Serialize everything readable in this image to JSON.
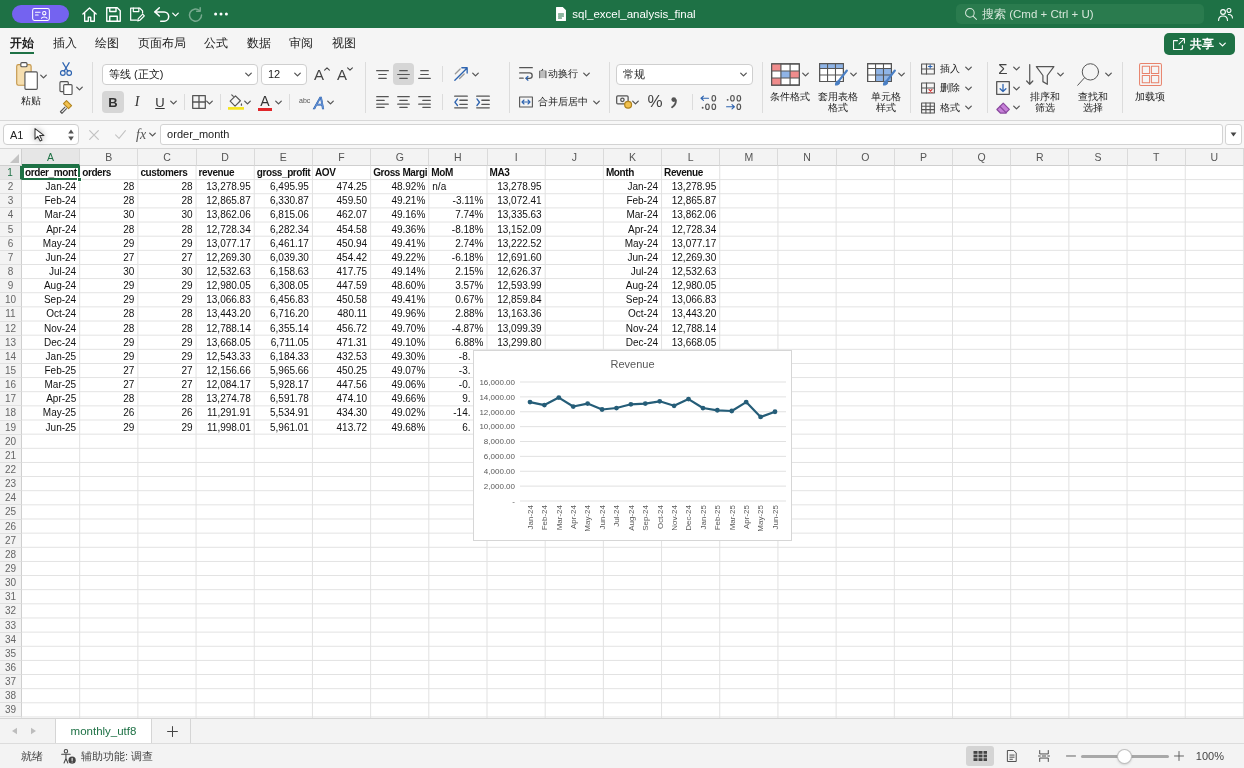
{
  "title_bar": {
    "redo": {
      "disabled": true
    },
    "title": "sql_excel_analysis_final",
    "search": {
      "placeholder": "搜索 (Cmd + Ctrl + U)"
    }
  },
  "ribbon": {
    "tabs": [
      {
        "label": "开始",
        "selected": true
      },
      {
        "label": "插入",
        "selected": false
      },
      {
        "label": "绘图",
        "selected": false
      },
      {
        "label": "页面布局",
        "selected": false
      },
      {
        "label": "公式",
        "selected": false
      },
      {
        "label": "数据",
        "selected": false
      },
      {
        "label": "审阅",
        "selected": false
      },
      {
        "label": "视图",
        "selected": false
      }
    ],
    "share_button": {
      "label": "共享"
    },
    "clipboard": {
      "paste": "粘贴"
    },
    "font": {
      "name": "等线 (正文)",
      "size": "12",
      "grow": "A",
      "shrink": "A",
      "styles": [
        {
          "kind": "bold",
          "label": "B",
          "selected": true
        },
        {
          "kind": "italic",
          "label": "I",
          "selected": false
        },
        {
          "kind": "underline",
          "label": "U",
          "selected": false
        }
      ],
      "font_color": "A",
      "text_effects": {
        "small": "abc",
        "large": "A"
      }
    },
    "alignment": {
      "vertical": [
        {
          "kind": "top",
          "selected": false
        },
        {
          "kind": "middle",
          "selected": true
        },
        {
          "kind": "bottom",
          "selected": false
        }
      ],
      "horizontal": [
        {
          "kind": "left",
          "selected": false
        },
        {
          "kind": "center",
          "selected": false
        },
        {
          "kind": "right",
          "selected": false
        }
      ],
      "wrap_text": "自动换行",
      "merge_center": "合并后居中"
    },
    "number": {
      "format": "常规",
      "percent": "%"
    },
    "styles": [
      "条件格式",
      "套用表格格式",
      "单元格样式"
    ],
    "cells": [
      "插入",
      "删除",
      "格式"
    ],
    "editing": {
      "autosum": "Σ",
      "sort_filter": "排序和筛选",
      "find_select": "查找和选择"
    },
    "add_ins": "加载项"
  },
  "formula_bar": {
    "name_box": "A1",
    "edit_buttons": [
      {
        "kind": "cancel",
        "disabled": true
      },
      {
        "kind": "confirm",
        "disabled": true
      }
    ],
    "function_button": "fx",
    "formula": "order_month"
  },
  "sheet": {
    "columns": [
      {
        "label": "A",
        "selected": true
      },
      {
        "label": "B",
        "selected": false
      },
      {
        "label": "C",
        "selected": false
      },
      {
        "label": "D",
        "selected": false
      },
      {
        "label": "E",
        "selected": false
      },
      {
        "label": "F",
        "selected": false
      },
      {
        "label": "G",
        "selected": false
      },
      {
        "label": "H",
        "selected": false
      },
      {
        "label": "I",
        "selected": false
      },
      {
        "label": "J",
        "selected": false
      },
      {
        "label": "K",
        "selected": false
      },
      {
        "label": "L",
        "selected": false
      },
      {
        "label": "M",
        "selected": false
      },
      {
        "label": "N",
        "selected": false
      },
      {
        "label": "O",
        "selected": false
      },
      {
        "label": "P",
        "selected": false
      },
      {
        "label": "Q",
        "selected": false
      },
      {
        "label": "R",
        "selected": false
      },
      {
        "label": "S",
        "selected": false
      },
      {
        "label": "T",
        "selected": false
      },
      {
        "label": "U",
        "selected": false
      }
    ],
    "rows": [
      {
        "label": "1",
        "selected": true
      },
      {
        "label": "2",
        "selected": false
      },
      {
        "label": "3",
        "selected": false
      },
      {
        "label": "4",
        "selected": false
      },
      {
        "label": "5",
        "selected": false
      },
      {
        "label": "6",
        "selected": false
      },
      {
        "label": "7",
        "selected": false
      },
      {
        "label": "8",
        "selected": false
      },
      {
        "label": "9",
        "selected": false
      },
      {
        "label": "10",
        "selected": false
      },
      {
        "label": "11",
        "selected": false
      },
      {
        "label": "12",
        "selected": false
      },
      {
        "label": "13",
        "selected": false
      },
      {
        "label": "14",
        "selected": false
      },
      {
        "label": "15",
        "selected": false
      },
      {
        "label": "16",
        "selected": false
      },
      {
        "label": "17",
        "selected": false
      },
      {
        "label": "18",
        "selected": false
      },
      {
        "label": "19",
        "selected": false
      },
      {
        "label": "20",
        "selected": false
      },
      {
        "label": "21",
        "selected": false
      },
      {
        "label": "22",
        "selected": false
      },
      {
        "label": "23",
        "selected": false
      },
      {
        "label": "24",
        "selected": false
      },
      {
        "label": "25",
        "selected": false
      },
      {
        "label": "26",
        "selected": false
      },
      {
        "label": "27",
        "selected": false
      },
      {
        "label": "28",
        "selected": false
      },
      {
        "label": "29",
        "selected": false
      },
      {
        "label": "30",
        "selected": false
      },
      {
        "label": "31",
        "selected": false
      },
      {
        "label": "32",
        "selected": false
      },
      {
        "label": "33",
        "selected": false
      },
      {
        "label": "34",
        "selected": false
      },
      {
        "label": "35",
        "selected": false
      },
      {
        "label": "36",
        "selected": false
      },
      {
        "label": "37",
        "selected": false
      },
      {
        "label": "38",
        "selected": false
      },
      {
        "label": "39",
        "selected": false
      }
    ],
    "ranges": [
      {
        "rows": [
          [
            {
              "text": "order_mont",
              "kind": "header"
            },
            {
              "text": "orders",
              "kind": "header"
            },
            {
              "text": "customers",
              "kind": "header"
            },
            {
              "text": "revenue",
              "kind": "header"
            },
            {
              "text": "gross_profit",
              "kind": "header"
            },
            {
              "text": "AOV",
              "kind": "header"
            },
            {
              "text": "Gross Margi",
              "kind": "header"
            },
            {
              "text": "MoM",
              "kind": "header"
            },
            {
              "text": "MA3",
              "kind": "header"
            }
          ],
          [
            {
              "text": "Jan-24",
              "kind": "number"
            },
            {
              "text": "28",
              "kind": "number"
            },
            {
              "text": "28",
              "kind": "number"
            },
            {
              "text": "13,278.95",
              "kind": "number"
            },
            {
              "text": "6,495.95",
              "kind": "number"
            },
            {
              "text": "474.25",
              "kind": "number"
            },
            {
              "text": "48.92%",
              "kind": "number"
            },
            {
              "text": "n/a",
              "kind": "text"
            },
            {
              "text": "13,278.95",
              "kind": "number"
            }
          ],
          [
            {
              "text": "Feb-24",
              "kind": "number"
            },
            {
              "text": "28",
              "kind": "number"
            },
            {
              "text": "28",
              "kind": "number"
            },
            {
              "text": "12,865.87",
              "kind": "number"
            },
            {
              "text": "6,330.87",
              "kind": "number"
            },
            {
              "text": "459.50",
              "kind": "number"
            },
            {
              "text": "49.21%",
              "kind": "number"
            },
            {
              "text": "-3.11%",
              "kind": "number"
            },
            {
              "text": "13,072.41",
              "kind": "number"
            }
          ],
          [
            {
              "text": "Mar-24",
              "kind": "number"
            },
            {
              "text": "30",
              "kind": "number"
            },
            {
              "text": "30",
              "kind": "number"
            },
            {
              "text": "13,862.06",
              "kind": "number"
            },
            {
              "text": "6,815.06",
              "kind": "number"
            },
            {
              "text": "462.07",
              "kind": "number"
            },
            {
              "text": "49.16%",
              "kind": "number"
            },
            {
              "text": "7.74%",
              "kind": "number"
            },
            {
              "text": "13,335.63",
              "kind": "number"
            }
          ],
          [
            {
              "text": "Apr-24",
              "kind": "number"
            },
            {
              "text": "28",
              "kind": "number"
            },
            {
              "text": "28",
              "kind": "number"
            },
            {
              "text": "12,728.34",
              "kind": "number"
            },
            {
              "text": "6,282.34",
              "kind": "number"
            },
            {
              "text": "454.58",
              "kind": "number"
            },
            {
              "text": "49.36%",
              "kind": "number"
            },
            {
              "text": "-8.18%",
              "kind": "number"
            },
            {
              "text": "13,152.09",
              "kind": "number"
            }
          ],
          [
            {
              "text": "May-24",
              "kind": "number"
            },
            {
              "text": "29",
              "kind": "number"
            },
            {
              "text": "29",
              "kind": "number"
            },
            {
              "text": "13,077.17",
              "kind": "number"
            },
            {
              "text": "6,461.17",
              "kind": "number"
            },
            {
              "text": "450.94",
              "kind": "number"
            },
            {
              "text": "49.41%",
              "kind": "number"
            },
            {
              "text": "2.74%",
              "kind": "number"
            },
            {
              "text": "13,222.52",
              "kind": "number"
            }
          ],
          [
            {
              "text": "Jun-24",
              "kind": "number"
            },
            {
              "text": "27",
              "kind": "number"
            },
            {
              "text": "27",
              "kind": "number"
            },
            {
              "text": "12,269.30",
              "kind": "number"
            },
            {
              "text": "6,039.30",
              "kind": "number"
            },
            {
              "text": "454.42",
              "kind": "number"
            },
            {
              "text": "49.22%",
              "kind": "number"
            },
            {
              "text": "-6.18%",
              "kind": "number"
            },
            {
              "text": "12,691.60",
              "kind": "number"
            }
          ],
          [
            {
              "text": "Jul-24",
              "kind": "number"
            },
            {
              "text": "30",
              "kind": "number"
            },
            {
              "text": "30",
              "kind": "number"
            },
            {
              "text": "12,532.63",
              "kind": "number"
            },
            {
              "text": "6,158.63",
              "kind": "number"
            },
            {
              "text": "417.75",
              "kind": "number"
            },
            {
              "text": "49.14%",
              "kind": "number"
            },
            {
              "text": "2.15%",
              "kind": "number"
            },
            {
              "text": "12,626.37",
              "kind": "number"
            }
          ],
          [
            {
              "text": "Aug-24",
              "kind": "number"
            },
            {
              "text": "29",
              "kind": "number"
            },
            {
              "text": "29",
              "kind": "number"
            },
            {
              "text": "12,980.05",
              "kind": "number"
            },
            {
              "text": "6,308.05",
              "kind": "number"
            },
            {
              "text": "447.59",
              "kind": "number"
            },
            {
              "text": "48.60%",
              "kind": "number"
            },
            {
              "text": "3.57%",
              "kind": "number"
            },
            {
              "text": "12,593.99",
              "kind": "number"
            }
          ],
          [
            {
              "text": "Sep-24",
              "kind": "number"
            },
            {
              "text": "29",
              "kind": "number"
            },
            {
              "text": "29",
              "kind": "number"
            },
            {
              "text": "13,066.83",
              "kind": "number"
            },
            {
              "text": "6,456.83",
              "kind": "number"
            },
            {
              "text": "450.58",
              "kind": "number"
            },
            {
              "text": "49.41%",
              "kind": "number"
            },
            {
              "text": "0.67%",
              "kind": "number"
            },
            {
              "text": "12,859.84",
              "kind": "number"
            }
          ],
          [
            {
              "text": "Oct-24",
              "kind": "number"
            },
            {
              "text": "28",
              "kind": "number"
            },
            {
              "text": "28",
              "kind": "number"
            },
            {
              "text": "13,443.20",
              "kind": "number"
            },
            {
              "text": "6,716.20",
              "kind": "number"
            },
            {
              "text": "480.11",
              "kind": "number"
            },
            {
              "text": "49.96%",
              "kind": "number"
            },
            {
              "text": "2.88%",
              "kind": "number"
            },
            {
              "text": "13,163.36",
              "kind": "number"
            }
          ],
          [
            {
              "text": "Nov-24",
              "kind": "number"
            },
            {
              "text": "28",
              "kind": "number"
            },
            {
              "text": "28",
              "kind": "number"
            },
            {
              "text": "12,788.14",
              "kind": "number"
            },
            {
              "text": "6,355.14",
              "kind": "number"
            },
            {
              "text": "456.72",
              "kind": "number"
            },
            {
              "text": "49.70%",
              "kind": "number"
            },
            {
              "text": "-4.87%",
              "kind": "number"
            },
            {
              "text": "13,099.39",
              "kind": "number"
            }
          ],
          [
            {
              "text": "Dec-24",
              "kind": "number"
            },
            {
              "text": "29",
              "kind": "number"
            },
            {
              "text": "29",
              "kind": "number"
            },
            {
              "text": "13,668.05",
              "kind": "number"
            },
            {
              "text": "6,711.05",
              "kind": "number"
            },
            {
              "text": "471.31",
              "kind": "number"
            },
            {
              "text": "49.10%",
              "kind": "number"
            },
            {
              "text": "6.88%",
              "kind": "number"
            },
            {
              "text": "13,299.80",
              "kind": "number"
            }
          ],
          [
            {
              "text": "Jan-25",
              "kind": "number"
            },
            {
              "text": "29",
              "kind": "number"
            },
            {
              "text": "29",
              "kind": "number"
            },
            {
              "text": "12,543.33",
              "kind": "number"
            },
            {
              "text": "6,184.33",
              "kind": "number"
            },
            {
              "text": "432.53",
              "kind": "number"
            },
            {
              "text": "49.30%",
              "kind": "number"
            },
            {
              "text": "-8.",
              "kind": "number"
            }
          ],
          [
            {
              "text": "Feb-25",
              "kind": "number"
            },
            {
              "text": "27",
              "kind": "number"
            },
            {
              "text": "27",
              "kind": "number"
            },
            {
              "text": "12,156.66",
              "kind": "number"
            },
            {
              "text": "5,965.66",
              "kind": "number"
            },
            {
              "text": "450.25",
              "kind": "number"
            },
            {
              "text": "49.07%",
              "kind": "number"
            },
            {
              "text": "-3.",
              "kind": "number"
            }
          ],
          [
            {
              "text": "Mar-25",
              "kind": "number"
            },
            {
              "text": "27",
              "kind": "number"
            },
            {
              "text": "27",
              "kind": "number"
            },
            {
              "text": "12,084.17",
              "kind": "number"
            },
            {
              "text": "5,928.17",
              "kind": "number"
            },
            {
              "text": "447.56",
              "kind": "number"
            },
            {
              "text": "49.06%",
              "kind": "number"
            },
            {
              "text": "-0.",
              "kind": "number"
            }
          ],
          [
            {
              "text": "Apr-25",
              "kind": "number"
            },
            {
              "text": "28",
              "kind": "number"
            },
            {
              "text": "28",
              "kind": "number"
            },
            {
              "text": "13,274.78",
              "kind": "number"
            },
            {
              "text": "6,591.78",
              "kind": "number"
            },
            {
              "text": "474.10",
              "kind": "number"
            },
            {
              "text": "49.66%",
              "kind": "number"
            },
            {
              "text": "9.",
              "kind": "number"
            }
          ],
          [
            {
              "text": "May-25",
              "kind": "number"
            },
            {
              "text": "26",
              "kind": "number"
            },
            {
              "text": "26",
              "kind": "number"
            },
            {
              "text": "11,291.91",
              "kind": "number"
            },
            {
              "text": "5,534.91",
              "kind": "number"
            },
            {
              "text": "434.30",
              "kind": "number"
            },
            {
              "text": "49.02%",
              "kind": "number"
            },
            {
              "text": "-14.",
              "kind": "number"
            }
          ],
          [
            {
              "text": "Jun-25",
              "kind": "number"
            },
            {
              "text": "29",
              "kind": "number"
            },
            {
              "text": "29",
              "kind": "number"
            },
            {
              "text": "11,998.01",
              "kind": "number"
            },
            {
              "text": "5,961.01",
              "kind": "number"
            },
            {
              "text": "413.72",
              "kind": "number"
            },
            {
              "text": "49.68%",
              "kind": "number"
            },
            {
              "text": "6.",
              "kind": "number"
            }
          ]
        ]
      },
      {
        "rows": [
          [
            {
              "text": "Month",
              "kind": "header"
            },
            {
              "text": "Revenue",
              "kind": "header"
            }
          ],
          [
            {
              "text": "Jan-24",
              "kind": "number"
            },
            {
              "text": "13,278.95",
              "kind": "number"
            }
          ],
          [
            {
              "text": "Feb-24",
              "kind": "number"
            },
            {
              "text": "12,865.87",
              "kind": "number"
            }
          ],
          [
            {
              "text": "Mar-24",
              "kind": "number"
            },
            {
              "text": "13,862.06",
              "kind": "number"
            }
          ],
          [
            {
              "text": "Apr-24",
              "kind": "number"
            },
            {
              "text": "12,728.34",
              "kind": "number"
            }
          ],
          [
            {
              "text": "May-24",
              "kind": "number"
            },
            {
              "text": "13,077.17",
              "kind": "number"
            }
          ],
          [
            {
              "text": "Jun-24",
              "kind": "number"
            },
            {
              "text": "12,269.30",
              "kind": "number"
            }
          ],
          [
            {
              "text": "Jul-24",
              "kind": "number"
            },
            {
              "text": "12,532.63",
              "kind": "number"
            }
          ],
          [
            {
              "text": "Aug-24",
              "kind": "number"
            },
            {
              "text": "12,980.05",
              "kind": "number"
            }
          ],
          [
            {
              "text": "Sep-24",
              "kind": "number"
            },
            {
              "text": "13,066.83",
              "kind": "number"
            }
          ],
          [
            {
              "text": "Oct-24",
              "kind": "number"
            },
            {
              "text": "13,443.20",
              "kind": "number"
            }
          ],
          [
            {
              "text": "Nov-24",
              "kind": "number"
            },
            {
              "text": "12,788.14",
              "kind": "number"
            }
          ],
          [
            {
              "text": "Dec-24",
              "kind": "number"
            },
            {
              "text": "13,668.05",
              "kind": "number"
            }
          ]
        ]
      }
    ],
    "chart": {
      "chart_data": {
        "type": "line",
        "title": "Revenue",
        "categories": [
          "Jan-24",
          "Feb-24",
          "Mar-24",
          "Apr-24",
          "May-24",
          "Jun-24",
          "Jul-24",
          "Aug-24",
          "Sep-24",
          "Oct-24",
          "Nov-24",
          "Dec-24",
          "Jan-25",
          "Feb-25",
          "Mar-25",
          "Apr-25",
          "May-25",
          "Jun-25"
        ],
        "series": [
          {
            "color": "#255d78",
            "values": [
              13300,
              12900,
              13900,
              12700,
              13100,
              12300,
              12500,
              13000,
              13100,
              13400,
              12800,
              13700,
              12500,
              12200,
              12100,
              13300,
              11300,
              12000
            ]
          }
        ],
        "ylim": [
          0,
          16000
        ],
        "yticks": [
          {
            "value": 0,
            "label": "-"
          },
          {
            "value": 2000,
            "label": "2,000.00"
          },
          {
            "value": 4000,
            "label": "4,000.00"
          },
          {
            "value": 6000,
            "label": "6,000.00"
          },
          {
            "value": 8000,
            "label": "8,000.00"
          },
          {
            "value": 10000,
            "label": "10,000.00"
          },
          {
            "value": 12000,
            "label": "12,000.00"
          },
          {
            "value": 14000,
            "label": "14,000.00"
          },
          {
            "value": 16000,
            "label": "16,000.00"
          }
        ],
        "grid": true
      }
    }
  },
  "sheet_bar": {
    "nav": [
      {
        "kind": "previous",
        "disabled": true
      },
      {
        "kind": "next",
        "disabled": true
      }
    ],
    "tabs": [
      {
        "label": "monthly_utf8",
        "selected": true
      }
    ]
  },
  "status_bar": {
    "status": "就绪",
    "accessibility": "辅助功能: 调查",
    "views": [
      {
        "kind": "normal",
        "selected": true
      },
      {
        "kind": "page_layout",
        "selected": false
      },
      {
        "kind": "page_break",
        "selected": false
      }
    ],
    "zoom": {
      "level": 0.5,
      "reading": "100%"
    }
  }
}
